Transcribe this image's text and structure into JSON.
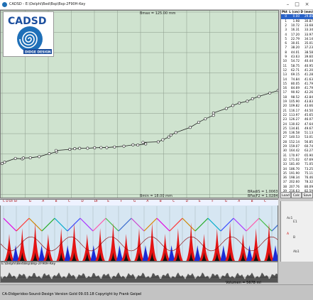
{
  "window": {
    "title": "CADSD - E:\\Delphi\\Bed\\Bsp\\Bsp-2F90H-Key",
    "minimize": "–",
    "maximize": "□",
    "close": "×"
  },
  "logo": {
    "text": "CADSD",
    "subtext": "DIDGE DESIGN"
  },
  "plot": {
    "label_top": "Bmax = 125.00 mm",
    "label_bottom": "Bmin = 18.00 mm",
    "radius_label_1": "BRadiS = 1.0063",
    "radius_label_2": "BFacF2 = 1.0284"
  },
  "table": {
    "headers": [
      "Pkt",
      "L (cm)",
      "D (mm)"
    ],
    "rows": [
      [
        "0",
        "0.00",
        "29.86"
      ],
      [
        "1",
        "1.98",
        "30.87"
      ],
      [
        "2",
        "10.72",
        "33.68"
      ],
      [
        "3",
        "16.31",
        "33.34"
      ],
      [
        "4",
        "17.20",
        "33.97"
      ],
      [
        "5",
        "22.79",
        "34.14"
      ],
      [
        "6",
        "30.01",
        "35.01"
      ],
      [
        "7",
        "38.20",
        "37.23"
      ],
      [
        "8",
        "44.01",
        "38.58"
      ],
      [
        "9",
        "43.63",
        "39.60"
      ],
      [
        "10",
        "54.72",
        "40.44"
      ],
      [
        "11",
        "58.75",
        "40.95"
      ],
      [
        "12",
        "62.71",
        "41.20"
      ],
      [
        "13",
        "69.15",
        "41.28"
      ],
      [
        "14",
        "74.84",
        "41.63"
      ],
      [
        "15",
        "80.05",
        "41.79"
      ],
      [
        "16",
        "84.69",
        "41.79"
      ],
      [
        "17",
        "90.92",
        "42.26"
      ],
      [
        "18",
        "98.52",
        "42.84"
      ],
      [
        "19",
        "105.90",
        "43.83"
      ],
      [
        "20",
        "109.82",
        "43.66"
      ],
      [
        "21",
        "116.17",
        "44.50"
      ],
      [
        "22",
        "113.97",
        "45.65"
      ],
      [
        "23",
        "126.27",
        "46.07"
      ],
      [
        "24",
        "130.02",
        "47.64"
      ],
      [
        "25",
        "134.81",
        "49.67"
      ],
      [
        "26",
        "136.58",
        "51.13"
      ],
      [
        "27",
        "140.53",
        "53.01"
      ],
      [
        "28",
        "152.14",
        "56.85"
      ],
      [
        "29",
        "159.07",
        "60.74"
      ],
      [
        "30",
        "164.42",
        "63.27"
      ],
      [
        "31",
        "170.97",
        "65.90"
      ],
      [
        "32",
        "171.02",
        "67.69"
      ],
      [
        "33",
        "181.40",
        "71.05"
      ],
      [
        "34",
        "186.70",
        "73.25"
      ],
      [
        "35",
        "191.90",
        "75.11"
      ],
      [
        "36",
        "198.34",
        "76.46"
      ],
      [
        "37",
        "202.60",
        "78.32"
      ],
      [
        "38",
        "207.76",
        "80.09"
      ],
      [
        "39",
        "216.63",
        "82.59"
      ],
      [
        "40",
        "223.40",
        "84.49"
      ]
    ],
    "selected_row": 0
  },
  "buttons": {
    "load": "Load",
    "calc": "Calc",
    "save": "Save"
  },
  "notes": [
    "C D DF E",
    "F",
    "G",
    "A",
    "B",
    "C",
    "D",
    "DF",
    "E",
    "F",
    "G",
    "A",
    "B",
    "C",
    "D",
    "E",
    "F",
    "G",
    "A",
    "B",
    "C"
  ],
  "side_labels": {
    "top": "1.0",
    "mid": "E1",
    "low": "Ab1",
    "a": "A",
    "b": "B",
    "blue": "Ac1"
  },
  "file_path": "E:\\Delphi\\Bed\\Bsp\\Bsp-2F90H-Key",
  "volume": "Volumen = 5678 ml",
  "status": "CA-Didgeridoo-Sound-Design Version Gold 09.03.18 Copyright by Frank Geipel"
}
